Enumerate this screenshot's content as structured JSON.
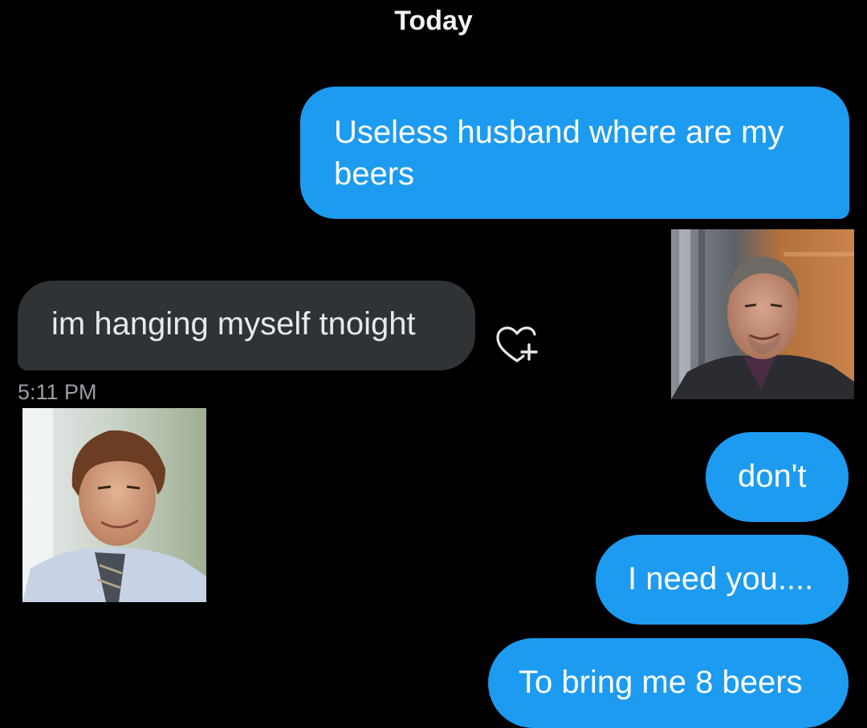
{
  "conversation": {
    "date_header": "Today",
    "messages": [
      {
        "direction": "outgoing",
        "text": "Useless husband where are my beers"
      },
      {
        "direction": "incoming",
        "text": "im hanging myself tnoight"
      },
      {
        "direction": "outgoing",
        "text": "don't"
      },
      {
        "direction": "outgoing",
        "text": "I need you...."
      },
      {
        "direction": "outgoing",
        "text": "To bring me 8 beers"
      }
    ],
    "timestamp": "5:11 PM"
  },
  "icons": {
    "react": "heart-plus-icon"
  },
  "colors": {
    "background": "#000000",
    "outgoing_bubble": "#1d9bf0",
    "incoming_bubble": "#2f3336",
    "timestamp_text": "#9aa0a6"
  }
}
